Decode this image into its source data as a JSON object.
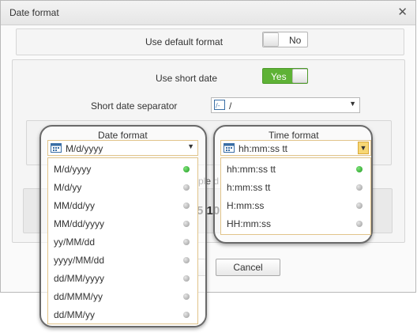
{
  "dialog": {
    "title": "Date format",
    "close_glyph": "✕"
  },
  "use_default": {
    "label": "Use default format",
    "toggle_text": "No"
  },
  "short_date": {
    "label": "Use short date",
    "toggle_text": "Yes"
  },
  "separator": {
    "label": "Short date separator",
    "value": "/"
  },
  "date_format": {
    "label": "Date format",
    "selected": "M/d/yyyy",
    "options": [
      "M/d/yyyy",
      "M/d/yy",
      "MM/dd/yy",
      "MM/dd/yyyy",
      "yy/MM/dd",
      "yyyy/MM/dd",
      "dd/MM/yyyy",
      "dd/MMM/yy",
      "dd/MM/yy"
    ]
  },
  "time_format": {
    "label": "Time format",
    "selected": "hh:mm:ss tt",
    "options": [
      "hh:mm:ss tt",
      "h:mm:ss tt",
      "H:mm:ss",
      "HH:mm:ss"
    ]
  },
  "example": {
    "label_fragment": "ple d",
    "value_fragment": "5 10"
  },
  "buttons": {
    "cancel": "Cancel"
  },
  "colors": {
    "accent_green": "#2a9d2a",
    "toggle_yes_bg": "#5eb236",
    "highlight_border": "#e1c48a"
  },
  "icons": {
    "calendar": "calendar-icon",
    "separator": "separator-icon"
  }
}
